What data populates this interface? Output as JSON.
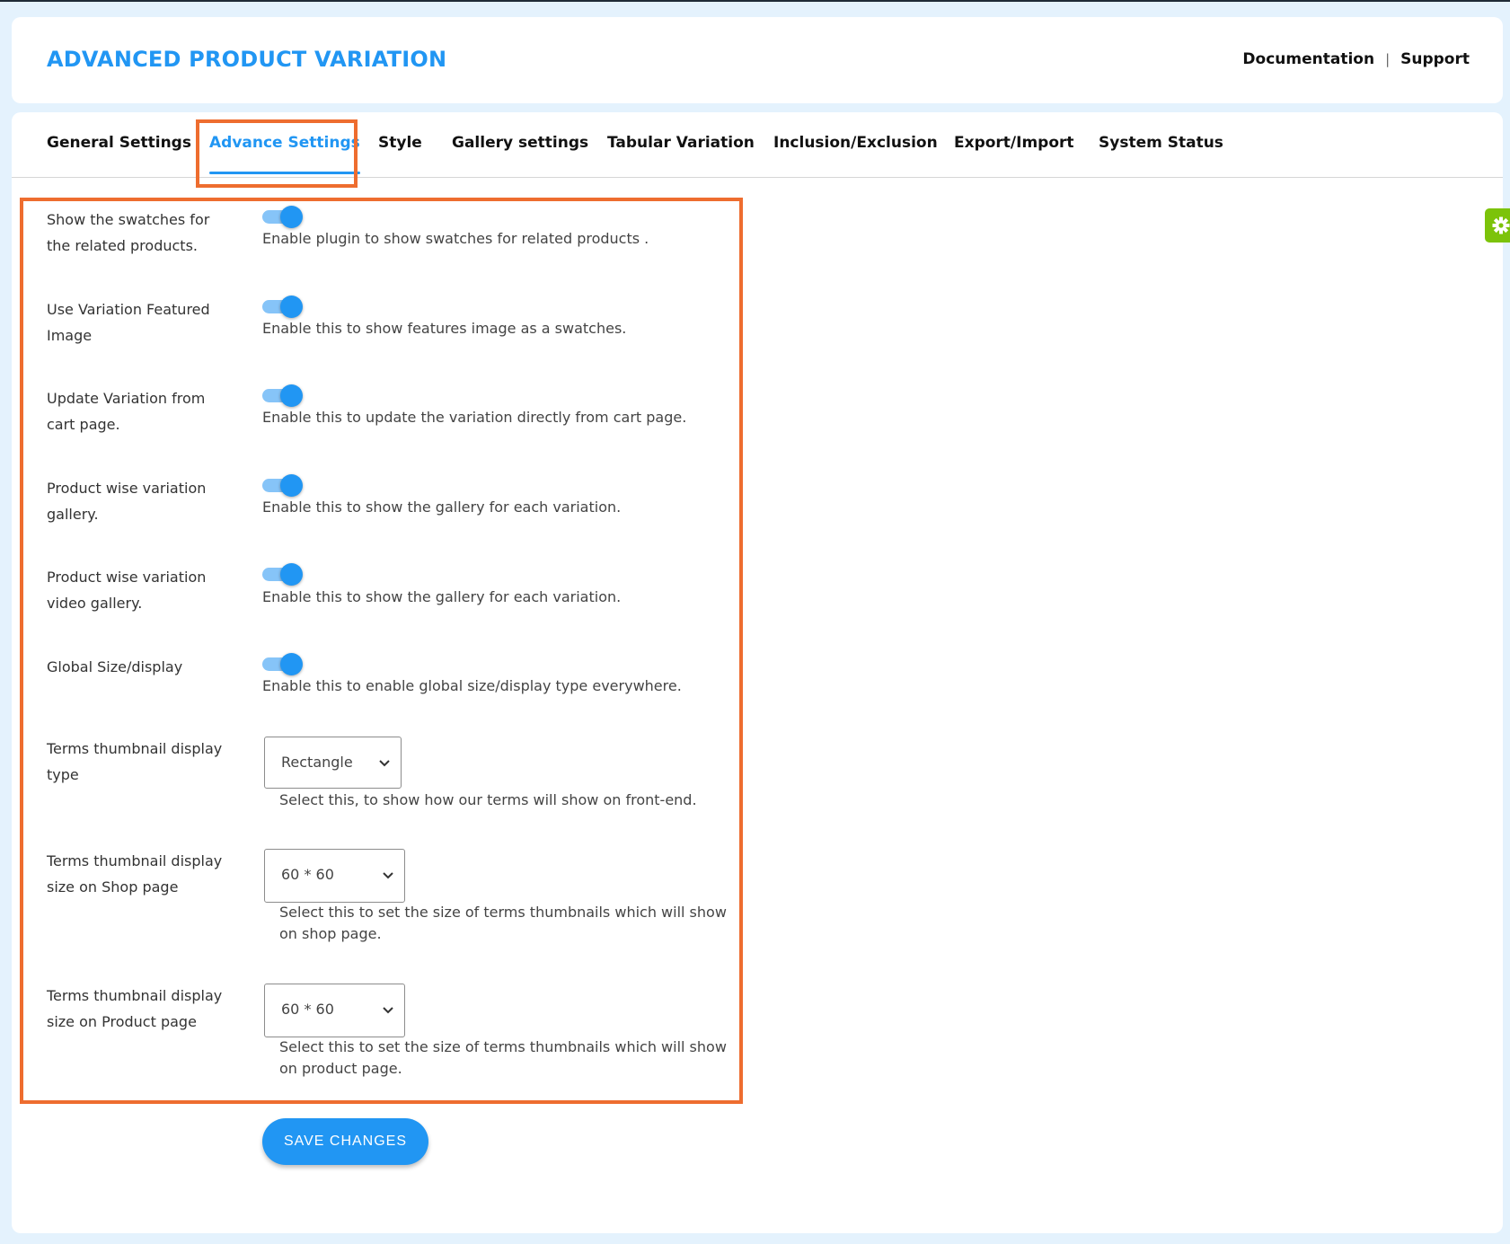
{
  "header": {
    "title": "ADVANCED PRODUCT VARIATION",
    "links": [
      {
        "label": "Documentation"
      },
      {
        "label": "Support"
      }
    ],
    "separator": "|"
  },
  "tabs": [
    {
      "label": "General Settings",
      "active": false
    },
    {
      "label": "Advance Settings",
      "active": true
    },
    {
      "label": "Style",
      "active": false
    },
    {
      "label": "Gallery settings",
      "active": false
    },
    {
      "label": "Tabular Variation",
      "active": false
    },
    {
      "label": "Inclusion/Exclusion",
      "active": false
    },
    {
      "label": "Export/Import",
      "active": false
    },
    {
      "label": "System Status",
      "active": false
    }
  ],
  "settings": {
    "toggles": [
      {
        "label_line1": "Show the swatches for",
        "label_line2": "the related products.",
        "enabled": true,
        "description": "Enable plugin to show swatches for related products ."
      },
      {
        "label_line1": "Use Variation Featured",
        "label_line2": "Image",
        "enabled": true,
        "description": "Enable this to show features image as a swatches."
      },
      {
        "label_line1": "Update Variation from",
        "label_line2": "cart page.",
        "enabled": true,
        "description": "Enable this to update the variation directly from cart page."
      },
      {
        "label_line1": "Product wise variation",
        "label_line2": "gallery.",
        "enabled": true,
        "description": "Enable this to show the gallery for each variation."
      },
      {
        "label_line1": "Product wise variation",
        "label_line2": "video gallery.",
        "enabled": true,
        "description": "Enable this to show the gallery for each variation."
      },
      {
        "label_line1": "Global Size/display",
        "label_line2": "",
        "enabled": true,
        "description": "Enable this to enable global size/display type everywhere."
      }
    ],
    "selects": [
      {
        "label_line1": "Terms thumbnail display",
        "label_line2": "type",
        "value": "Rectangle",
        "description": "Select this, to show how our terms will show on front-end."
      },
      {
        "label_line1": "Terms thumbnail display",
        "label_line2": "size on Shop page",
        "value": "60 * 60",
        "description": "Select this to set the size of terms thumbnails which will show on shop page."
      },
      {
        "label_line1": "Terms thumbnail display",
        "label_line2": "size on Product page",
        "value": "60 * 60",
        "description": "Select this to set the size of terms thumbnails which will show on product page."
      }
    ]
  },
  "actions": {
    "save_label": "SAVE CHANGES"
  },
  "colors": {
    "accent": "#2196f3",
    "highlight": "#ee6d2f",
    "gear_tab": "#7cc30a",
    "background": "#e4f2fd"
  }
}
